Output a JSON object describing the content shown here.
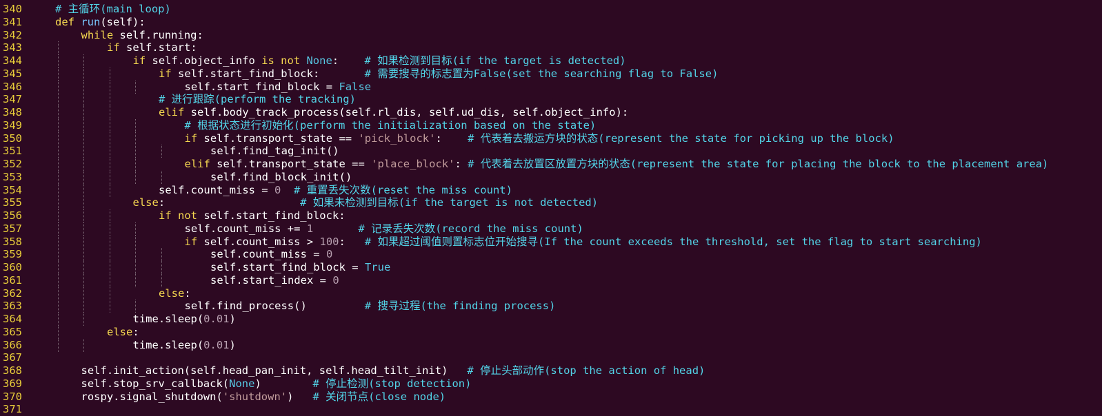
{
  "editor": {
    "colors": {
      "background": "#2d0922",
      "line_number": "#e8cd3a",
      "keyword": "#f5d750",
      "builtin": "#57c7e3",
      "comment": "#52d4e8",
      "string": "#c09b9b",
      "number": "#b8a0b0",
      "text": "#ffffff"
    },
    "lines": [
      {
        "n": "340",
        "indent": 0,
        "tokens": [
          {
            "t": "cm",
            "v": "# 主循环(main loop)"
          }
        ]
      },
      {
        "n": "341",
        "indent": 0,
        "tokens": [
          {
            "t": "kw",
            "v": "def "
          },
          {
            "t": "fn",
            "v": "run"
          },
          {
            "t": "tx",
            "v": "(self):"
          }
        ]
      },
      {
        "n": "342",
        "indent": 1,
        "tokens": [
          {
            "t": "kw",
            "v": "while "
          },
          {
            "t": "tx",
            "v": "self.running:"
          }
        ]
      },
      {
        "n": "343",
        "indent": 2,
        "tokens": [
          {
            "t": "kw",
            "v": "if "
          },
          {
            "t": "tx",
            "v": "self.start:"
          }
        ]
      },
      {
        "n": "344",
        "indent": 3,
        "tokens": [
          {
            "t": "kw",
            "v": "if "
          },
          {
            "t": "tx",
            "v": "self.object_info "
          },
          {
            "t": "kw",
            "v": "is not "
          },
          {
            "t": "bi",
            "v": "None"
          },
          {
            "t": "tx",
            "v": ":    "
          },
          {
            "t": "cm",
            "v": "# 如果检测到目标(if the target is detected)"
          }
        ]
      },
      {
        "n": "345",
        "indent": 4,
        "tokens": [
          {
            "t": "kw",
            "v": "if "
          },
          {
            "t": "tx",
            "v": "self.start_find_block:       "
          },
          {
            "t": "cm",
            "v": "# 需要搜寻的标志置为False(set the searching flag to False)"
          }
        ]
      },
      {
        "n": "346",
        "indent": 5,
        "tokens": [
          {
            "t": "tx",
            "v": "self.start_find_block = "
          },
          {
            "t": "bi",
            "v": "False"
          }
        ]
      },
      {
        "n": "347",
        "indent": 4,
        "tokens": [
          {
            "t": "cm",
            "v": "# 进行跟踪(perform the tracking)"
          }
        ]
      },
      {
        "n": "348",
        "indent": 4,
        "tokens": [
          {
            "t": "kw",
            "v": "elif "
          },
          {
            "t": "tx",
            "v": "self.body_track_process(self.rl_dis, self.ud_dis, self.object_info):"
          }
        ]
      },
      {
        "n": "349",
        "indent": 5,
        "tokens": [
          {
            "t": "cm",
            "v": "# 根据状态进行初始化(perform the initialization based on the state)"
          }
        ]
      },
      {
        "n": "350",
        "indent": 5,
        "tokens": [
          {
            "t": "kw",
            "v": "if "
          },
          {
            "t": "tx",
            "v": "self.transport_state == "
          },
          {
            "t": "str",
            "v": "'pick_block'"
          },
          {
            "t": "tx",
            "v": ":    "
          },
          {
            "t": "cm",
            "v": "# 代表着去搬运方块的状态(represent the state for picking up the block)"
          }
        ]
      },
      {
        "n": "351",
        "indent": 6,
        "tokens": [
          {
            "t": "tx",
            "v": "self.find_tag_init()"
          }
        ]
      },
      {
        "n": "352",
        "indent": 5,
        "tokens": [
          {
            "t": "kw",
            "v": "elif "
          },
          {
            "t": "tx",
            "v": "self.transport_state == "
          },
          {
            "t": "str",
            "v": "'place_block'"
          },
          {
            "t": "tx",
            "v": ": "
          },
          {
            "t": "cm",
            "v": "# 代表着去放置区放置方块的状态(represent the state for placing the block to the placement area)"
          }
        ]
      },
      {
        "n": "353",
        "indent": 6,
        "tokens": [
          {
            "t": "tx",
            "v": "self.find_block_init()"
          }
        ]
      },
      {
        "n": "354",
        "indent": 4,
        "tokens": [
          {
            "t": "tx",
            "v": "self.count_miss = "
          },
          {
            "t": "num",
            "v": "0"
          },
          {
            "t": "tx",
            "v": "  "
          },
          {
            "t": "cm",
            "v": "# 重置丢失次数(reset the miss count)"
          }
        ]
      },
      {
        "n": "355",
        "indent": 3,
        "tokens": [
          {
            "t": "kw",
            "v": "else"
          },
          {
            "t": "tx",
            "v": ":                     "
          },
          {
            "t": "cm",
            "v": "# 如果未检测到目标(if the target is not detected)"
          }
        ]
      },
      {
        "n": "356",
        "indent": 4,
        "tokens": [
          {
            "t": "kw",
            "v": "if not "
          },
          {
            "t": "tx",
            "v": "self.start_find_block:"
          }
        ]
      },
      {
        "n": "357",
        "indent": 5,
        "tokens": [
          {
            "t": "tx",
            "v": "self.count_miss += "
          },
          {
            "t": "num",
            "v": "1"
          },
          {
            "t": "tx",
            "v": "       "
          },
          {
            "t": "cm",
            "v": "# 记录丢失次数(record the miss count)"
          }
        ]
      },
      {
        "n": "358",
        "indent": 5,
        "tokens": [
          {
            "t": "kw",
            "v": "if "
          },
          {
            "t": "tx",
            "v": "self.count_miss > "
          },
          {
            "t": "num",
            "v": "100"
          },
          {
            "t": "tx",
            "v": ":   "
          },
          {
            "t": "cm",
            "v": "# 如果超过阈值则置标志位开始搜寻(If the count exceeds the threshold, set the flag to start searching)"
          }
        ]
      },
      {
        "n": "359",
        "indent": 6,
        "tokens": [
          {
            "t": "tx",
            "v": "self.count_miss = "
          },
          {
            "t": "num",
            "v": "0"
          }
        ]
      },
      {
        "n": "360",
        "indent": 6,
        "tokens": [
          {
            "t": "tx",
            "v": "self.start_find_block = "
          },
          {
            "t": "bi",
            "v": "True"
          }
        ]
      },
      {
        "n": "361",
        "indent": 6,
        "tokens": [
          {
            "t": "tx",
            "v": "self.start_index = "
          },
          {
            "t": "num",
            "v": "0"
          }
        ]
      },
      {
        "n": "362",
        "indent": 4,
        "tokens": [
          {
            "t": "kw",
            "v": "else"
          },
          {
            "t": "tx",
            "v": ":"
          }
        ]
      },
      {
        "n": "363",
        "indent": 5,
        "tokens": [
          {
            "t": "tx",
            "v": "self.find_process()         "
          },
          {
            "t": "cm",
            "v": "# 搜寻过程(the finding process)"
          }
        ]
      },
      {
        "n": "364",
        "indent": 3,
        "tokens": [
          {
            "t": "tx",
            "v": "time.sleep("
          },
          {
            "t": "num",
            "v": "0.01"
          },
          {
            "t": "tx",
            "v": ")"
          }
        ]
      },
      {
        "n": "365",
        "indent": 2,
        "tokens": [
          {
            "t": "kw",
            "v": "else"
          },
          {
            "t": "tx",
            "v": ":"
          }
        ]
      },
      {
        "n": "366",
        "indent": 3,
        "tokens": [
          {
            "t": "tx",
            "v": "time.sleep("
          },
          {
            "t": "num",
            "v": "0.01"
          },
          {
            "t": "tx",
            "v": ")"
          }
        ]
      },
      {
        "n": "367",
        "indent": 0,
        "tokens": []
      },
      {
        "n": "368",
        "indent": 1,
        "tokens": [
          {
            "t": "tx",
            "v": "self.init_action(self.head_pan_init, self.head_tilt_init)   "
          },
          {
            "t": "cm",
            "v": "# 停止头部动作(stop the action of head)"
          }
        ]
      },
      {
        "n": "369",
        "indent": 1,
        "tokens": [
          {
            "t": "tx",
            "v": "self.stop_srv_callback("
          },
          {
            "t": "bi",
            "v": "None"
          },
          {
            "t": "tx",
            "v": ")        "
          },
          {
            "t": "cm",
            "v": "# 停止检测(stop detection)"
          }
        ]
      },
      {
        "n": "370",
        "indent": 1,
        "tokens": [
          {
            "t": "tx",
            "v": "rospy.signal_shutdown("
          },
          {
            "t": "str",
            "v": "'shutdown'"
          },
          {
            "t": "tx",
            "v": ")   "
          },
          {
            "t": "cm",
            "v": "# 关闭节点(close node)"
          }
        ]
      },
      {
        "n": "371",
        "indent": 0,
        "tokens": []
      }
    ]
  }
}
